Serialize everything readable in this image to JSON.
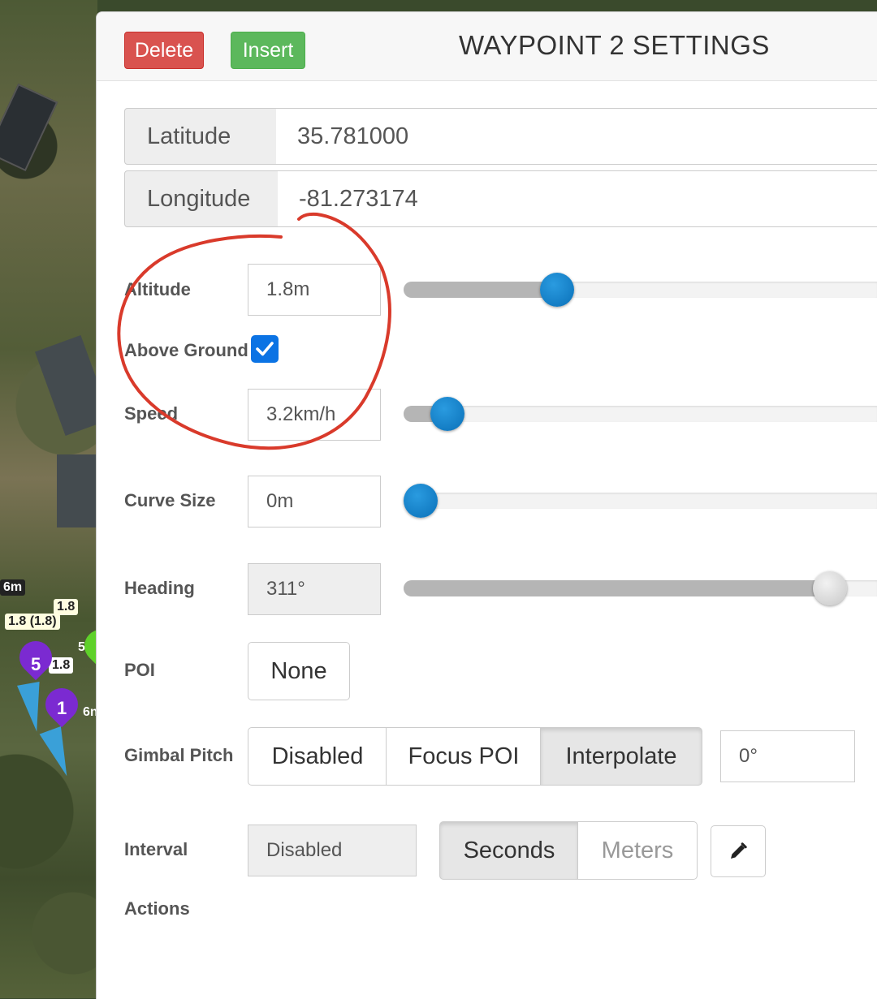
{
  "map": {
    "labels": [
      "6m",
      "1.8 (1.8)",
      "1.8",
      "1.8",
      "5",
      "6n"
    ],
    "pins": [
      {
        "num": "5",
        "color": "#7b2ad1"
      },
      {
        "num": "1",
        "color": "#7b2ad1"
      },
      {
        "num": "",
        "color": "#5fd12a"
      }
    ]
  },
  "header": {
    "delete_label": "Delete",
    "insert_label": "Insert",
    "title": "WAYPOINT 2 SETTINGS",
    "delete_color": "#d9534f",
    "insert_color": "#5cb85c"
  },
  "coords": {
    "latitude_label": "Latitude",
    "latitude_value": "35.781000",
    "longitude_label": "Longitude",
    "longitude_value": "-81.273174"
  },
  "altitude": {
    "label": "Altitude",
    "value": "1.8m",
    "slider_fraction": 0.31
  },
  "above_ground": {
    "label": "Above Ground",
    "checked": true
  },
  "speed": {
    "label": "Speed",
    "value": "3.2km/h",
    "slider_fraction": 0.06
  },
  "curve_size": {
    "label": "Curve Size",
    "value": "0m",
    "slider_fraction": 0.0
  },
  "heading": {
    "label": "Heading",
    "value": "311°",
    "slider_fraction": 0.93
  },
  "poi": {
    "label": "POI",
    "value": "None"
  },
  "gimbal_pitch": {
    "label": "Gimbal Pitch",
    "options": [
      "Disabled",
      "Focus POI",
      "Interpolate"
    ],
    "selected": "Interpolate",
    "value": "0°"
  },
  "interval": {
    "label": "Interval",
    "value": "Disabled",
    "units": [
      "Seconds",
      "Meters"
    ],
    "selected_unit": "Seconds"
  },
  "actions": {
    "label": "Actions"
  },
  "colors": {
    "accent": "#0b73e4",
    "slider_thumb": "#1a86cc",
    "annotation": "#d93a2b"
  }
}
